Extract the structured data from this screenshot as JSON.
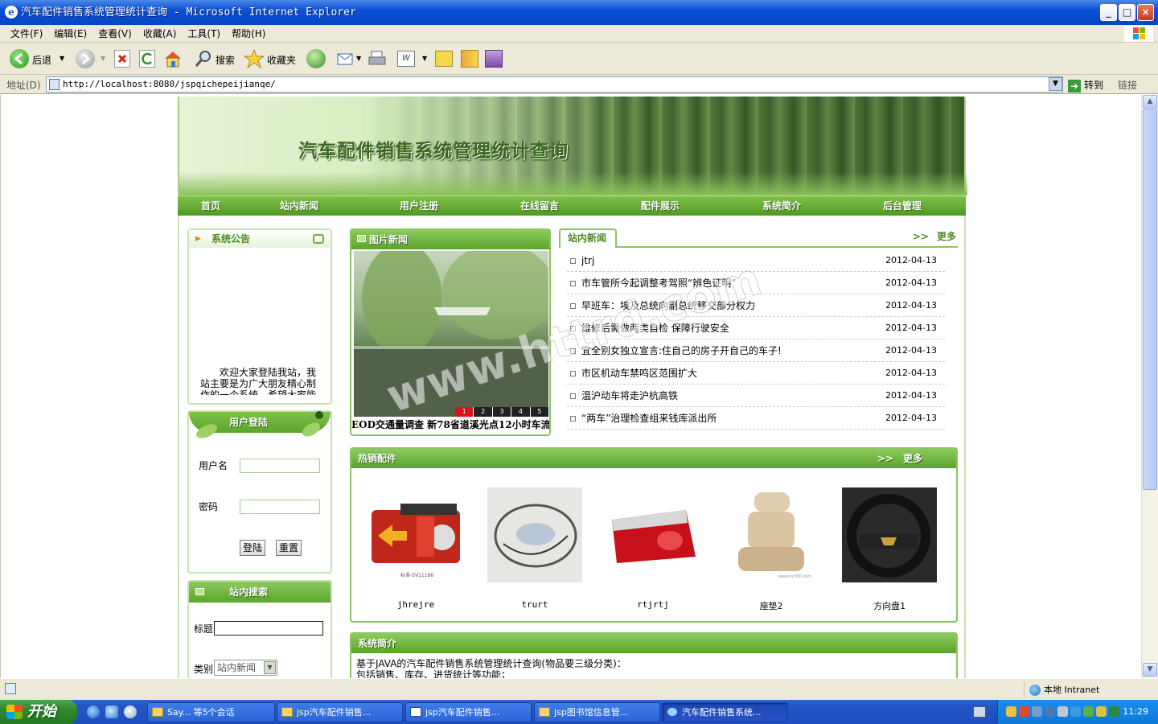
{
  "window": {
    "title": "汽车配件销售系统管理统计查询 - Microsoft Internet Explorer",
    "min": "_",
    "max": "□",
    "close": "×"
  },
  "menu": [
    "文件(F)",
    "编辑(E)",
    "查看(V)",
    "收藏(A)",
    "工具(T)",
    "帮助(H)"
  ],
  "toolbar": {
    "back": "后退",
    "search": "搜索",
    "favorites": "收藏夹"
  },
  "address": {
    "label": "地址(D)",
    "url": "http://localhost:8080/jspqichepeijianqe/",
    "go": "转到",
    "links": "链接"
  },
  "site": {
    "title": "汽车配件销售系统管理统计查询",
    "nav": [
      "首页",
      "站内新闻",
      "用户注册",
      "在线留言",
      "配件展示",
      "系统简介",
      "后台管理"
    ],
    "notice": {
      "heading": "系统公告",
      "text": "欢迎大家登陆我站，我站主要是为广大朋友精心制作的一个系统，希望大家能"
    },
    "login": {
      "heading": "用户登陆",
      "username_label": "用户名",
      "password_label": "密码",
      "login_btn": "登陆",
      "reset_btn": "重置"
    },
    "search": {
      "heading": "站内搜索",
      "title_label": "标题",
      "type_label": "类别",
      "type_value": "站内新闻"
    },
    "photo_news": {
      "heading": "图片新闻",
      "caption": "EOD交通量调查 新78省道溪光点12小时车流",
      "pages": [
        "1",
        "2",
        "3",
        "4",
        "5"
      ]
    },
    "site_news": {
      "heading": "站内新闻",
      "more": "更多",
      "items": [
        {
          "title": "jtrj",
          "date": "2012-04-13"
        },
        {
          "title": "市车管所今起调整考驾照“辨色证明”",
          "date": "2012-04-13"
        },
        {
          "title": "早班车：埃及总统向副总统移交部分权力",
          "date": "2012-04-13"
        },
        {
          "title": "维修后需做两类自检 保障行驶安全",
          "date": "2012-04-13"
        },
        {
          "title": "宜全别女独立宣言:住自己的房子开自己的车子!",
          "date": "2012-04-13"
        },
        {
          "title": "市区机动车禁鸣区范围扩大",
          "date": "2012-04-13"
        },
        {
          "title": "温沪动车将走沪杭高铁",
          "date": "2012-04-13"
        },
        {
          "title": "“两车”治理检查组来钱库派出所",
          "date": "2012-04-13"
        }
      ]
    },
    "hot_parts": {
      "heading": "热销配件",
      "more": "更多",
      "items": [
        {
          "name": "jhrejre",
          "img_text": "标准-SV11186"
        },
        {
          "name": "trurt"
        },
        {
          "name": "rtjrtj"
        },
        {
          "name": "座垫2",
          "img_text": "www.hc360.com"
        },
        {
          "name": "方向盘1"
        }
      ]
    },
    "intro": {
      "heading": "系统简介",
      "line1": "基于JAVA的汽车配件销售系统管理统计查询(物品要三级分类)：",
      "line2": "包括销售、库存、进货统计等功能；"
    },
    "watermark": "www.httrd.com"
  },
  "status": {
    "zone": "本地 Intranet"
  },
  "taskbar": {
    "start": "开始",
    "tasks": [
      "Say... 等5个会话",
      "jsp汽车配件销售...",
      "jsp汽车配件销售...",
      "jsp图书馆信息管...",
      "汽车配件销售系统..."
    ],
    "clock": "11:29"
  }
}
